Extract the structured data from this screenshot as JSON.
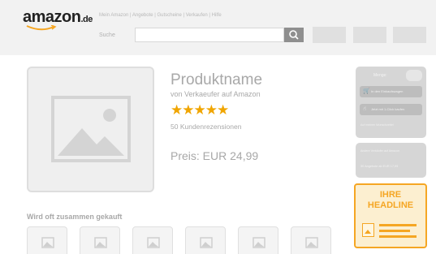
{
  "header": {
    "logo_text": "amazon",
    "logo_tld": ".de",
    "nav_text": "Mein Amazon | Angebote | Gutscheine | Verkaufen | Hilfe",
    "search_label": "Suche",
    "search_value": "",
    "search_icon": "magnifier-icon"
  },
  "product": {
    "name": "Produktname",
    "seller": "von Verkaeufer auf Amazon",
    "stars": "★★★★★",
    "rating": 5,
    "reviews": "50 Kundenrezensionen",
    "price": "Preis: EUR 24,99"
  },
  "buybox": {
    "qty_label": "Menge:",
    "cart_label": "In den Einkaufswagen",
    "oneclick_label": "Jetzt mit 1-Click kaufen",
    "note": "Auf meinen Wunschzettel"
  },
  "offers": {
    "line1": "Andere Verkäufer auf Amazon",
    "line2": "30 Angebote ab EUR 17,99"
  },
  "ad": {
    "headline_1": "IHRE",
    "headline_2": "HEADLINE",
    "accent": "#f5a623"
  },
  "related": {
    "title": "Wird oft zusammen gekauft"
  }
}
